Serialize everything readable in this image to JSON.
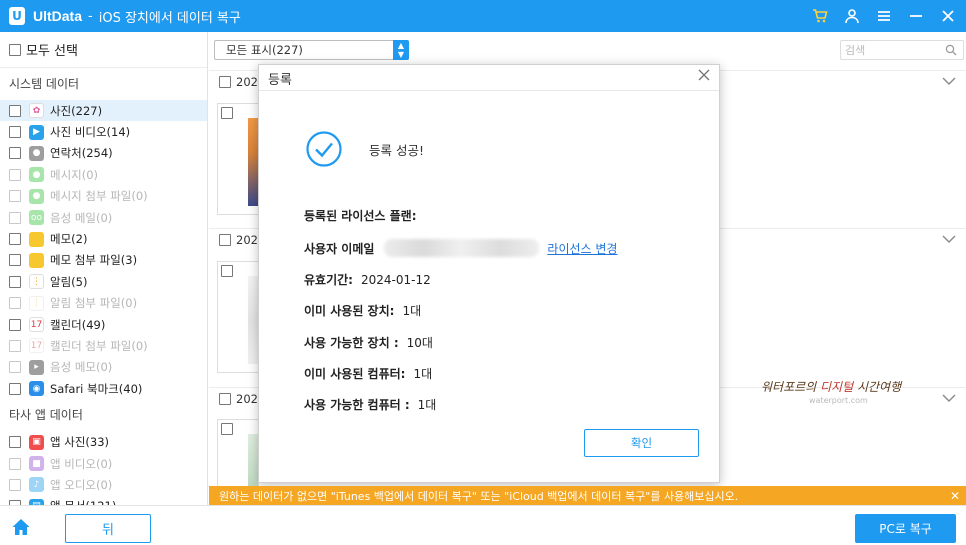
{
  "titlebar": {
    "app_name": "UltData",
    "separator": "-",
    "subtitle": "iOS 장치에서 데이터 복구",
    "logo_letter": "U",
    "icons": [
      "cart-icon",
      "user-icon",
      "menu-icon",
      "minimize-icon",
      "close-icon"
    ],
    "accent": "#1e9af0"
  },
  "sidebar": {
    "select_all": "모두 선택",
    "system_title": "시스템 데이터",
    "system_items": [
      {
        "label": "사진(227)",
        "icon": "photos-icon",
        "color": "#ffffff",
        "dim": false,
        "active": true
      },
      {
        "label": "사진 비디오(14)",
        "icon": "video-icon",
        "color": "#2aa2e9",
        "dim": false
      },
      {
        "label": "연락처(254)",
        "icon": "contacts-icon",
        "color": "#9e9e9e",
        "dim": false
      },
      {
        "label": "메시지(0)",
        "icon": "messages-icon",
        "color": "#3fc744",
        "dim": true
      },
      {
        "label": "메시지 첨부 파일(0)",
        "icon": "messages-attachment-icon",
        "color": "#3fc744",
        "dim": true
      },
      {
        "label": "음성 메일(0)",
        "icon": "voicemail-icon",
        "color": "#3fc744",
        "dim": true
      },
      {
        "label": "메모(2)",
        "icon": "notes-icon",
        "color": "#f7c82d",
        "dim": false
      },
      {
        "label": "메모 첨부 파일(3)",
        "icon": "notes-attachment-icon",
        "color": "#f7c82d",
        "dim": false
      },
      {
        "label": "알림(5)",
        "icon": "reminders-icon",
        "color": "#ffffff",
        "dim": false
      },
      {
        "label": "알림 첨부 파일(0)",
        "icon": "reminders-attachment-icon",
        "color": "#ffffff",
        "dim": true
      },
      {
        "label": "캘린더(49)",
        "icon": "calendar-icon",
        "color": "#ffffff",
        "dim": false
      },
      {
        "label": "캘린더 첨부 파일(0)",
        "icon": "calendar-attachment-icon",
        "color": "#ffffff",
        "dim": true
      },
      {
        "label": "음성 메모(0)",
        "icon": "voice-memo-icon",
        "color": "#2b2b2b",
        "dim": true
      },
      {
        "label": "Safari 북마크(40)",
        "icon": "safari-icon",
        "color": "#2a8fe8",
        "dim": false
      }
    ],
    "thirdparty_title": "타사 앱 데이터",
    "thirdparty_items": [
      {
        "label": "앱 사진(33)",
        "icon": "app-photo-icon",
        "color": "#f04e4e",
        "dim": false
      },
      {
        "label": "앱 비디오(0)",
        "icon": "app-video-icon",
        "color": "#9b59d6",
        "dim": true
      },
      {
        "label": "앱 오디오(0)",
        "icon": "app-audio-icon",
        "color": "#2aa2e9",
        "dim": true
      },
      {
        "label": "앱 문서(121)",
        "icon": "app-doc-icon",
        "color": "#2aa2e9",
        "dim": false
      }
    ]
  },
  "main": {
    "filter_value": "모든 표시(227)",
    "search_placeholder": "검색",
    "group_dates": [
      "2022",
      "2022",
      "2022"
    ],
    "watermark_main": "워터포르의 ",
    "watermark_highlight": "디지털",
    "watermark_tail": " 시간여행",
    "watermark_sub": "waterport.com"
  },
  "dialog": {
    "title": "등록",
    "success_text": "등록 성공!",
    "plan_label": "등록된 라이선스 플랜:",
    "email_key": "사용자 이메일",
    "change_license_link": "라이선스 변경",
    "rows": [
      {
        "key": "유효기간:",
        "value": "2024-01-12"
      },
      {
        "key": "이미 사용된 장치:",
        "value": "1대"
      },
      {
        "key": "사용 가능한 장치 :",
        "value": "10대"
      },
      {
        "key": "이미 사용된 컴퓨터:",
        "value": "1대"
      },
      {
        "key": "사용 가능한 컴퓨터 :",
        "value": "1대"
      }
    ],
    "ok_button": "확인"
  },
  "notice": {
    "text": "원하는 데이터가 없으면 \"iTunes 백업에서 데이터 복구\" 또는 \"iCloud 백업에서 데이터 복구\"를 사용해보십시오.",
    "color": "#f5a623"
  },
  "bottombar": {
    "back_label": "뒤",
    "recover_label": "PC로 복구"
  }
}
